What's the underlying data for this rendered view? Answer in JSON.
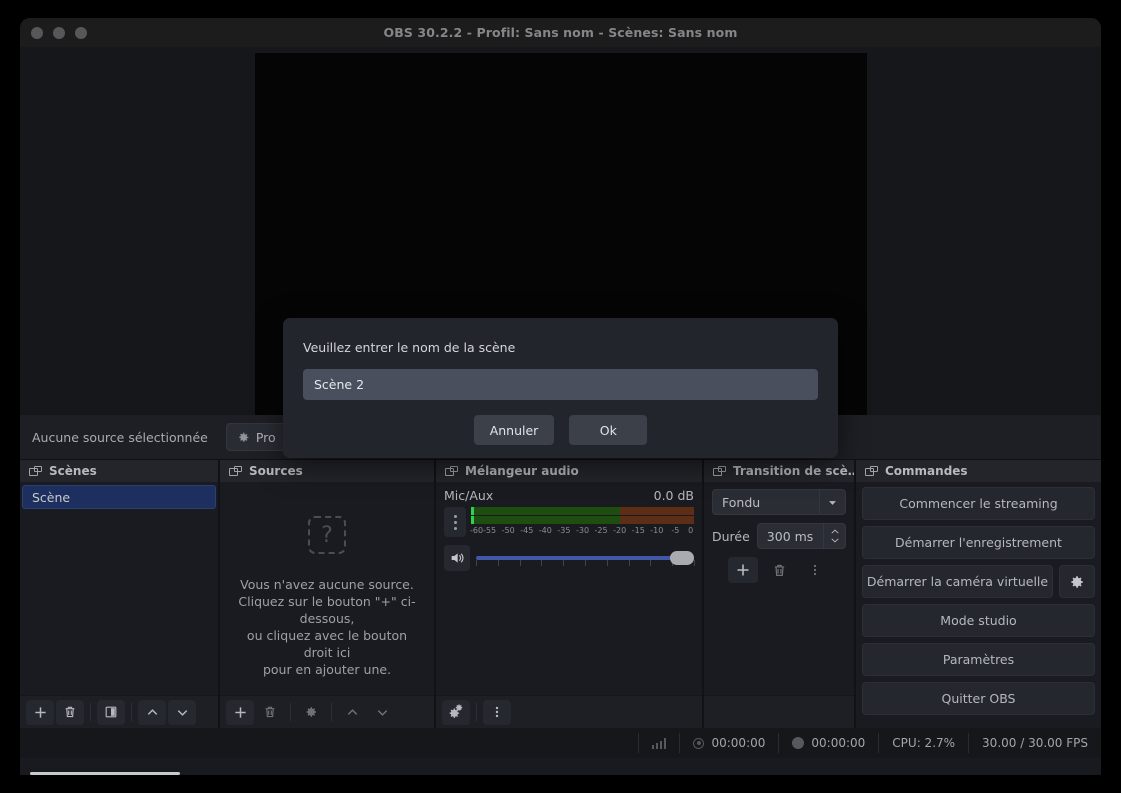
{
  "window": {
    "title": "OBS 30.2.2 - Profil: Sans nom - Scènes: Sans nom"
  },
  "source_toolbar": {
    "no_source_label": "Aucune source sélectionnée",
    "properties_label": "Pro"
  },
  "scenes": {
    "title": "Scènes",
    "items": [
      {
        "label": "Scène",
        "selected": true
      }
    ],
    "toolbar": [
      "add-icon",
      "remove-icon",
      "scene-filters-icon",
      "move-up-icon",
      "move-down-icon"
    ]
  },
  "sources": {
    "title": "Sources",
    "empty_text": "Vous n'avez aucune source.\nCliquez sur le bouton \"+\" ci-dessous,\nou cliquez avec le bouton droit ici\npour en ajouter une.",
    "toolbar": [
      "add-icon",
      "remove-icon",
      "gear-icon",
      "move-up-icon",
      "move-down-icon"
    ]
  },
  "mixer": {
    "title": "Mélangeur audio",
    "channel_name": "Mic/Aux",
    "channel_db": "0.0 dB",
    "scale_labels": [
      "-60",
      "-55",
      "-50",
      "-45",
      "-40",
      "-35",
      "-30",
      "-25",
      "-20",
      "-15",
      "-10",
      "-5",
      "0"
    ],
    "volume_percent": 100,
    "toolbar": [
      "advanced-audio-properties-icon",
      "menu-icon"
    ]
  },
  "transitions": {
    "title": "Transition de scè…",
    "selected_transition": "Fondu",
    "duration_label": "Durée",
    "duration_value": "300 ms",
    "toolbar": [
      "add-icon",
      "remove-icon",
      "menu-icon"
    ]
  },
  "commands": {
    "title": "Commandes",
    "buttons": [
      {
        "label": "Commencer le streaming",
        "has_gear": false
      },
      {
        "label": "Démarrer l'enregistrement",
        "has_gear": false
      },
      {
        "label": "Démarrer la caméra virtuelle",
        "has_gear": true
      },
      {
        "label": "Mode studio",
        "has_gear": false
      },
      {
        "label": "Paramètres",
        "has_gear": false
      },
      {
        "label": "Quitter OBS",
        "has_gear": false
      }
    ]
  },
  "status_bar": {
    "stream_time": "00:00:00",
    "record_time": "00:00:00",
    "cpu": "CPU: 2.7%",
    "fps": "30.00 / 30.00 FPS"
  },
  "dialog": {
    "label": "Veuillez entrer le nom de la scène",
    "input_value": "Scène 2",
    "cancel_label": "Annuler",
    "ok_label": "Ok"
  },
  "colors": {
    "selection_blue": "#1d2f5e",
    "slider_blue": "#4257a8",
    "meter_green": "#1e4d10",
    "meter_red": "#5e2d16",
    "peak_green": "#2fd24a"
  }
}
